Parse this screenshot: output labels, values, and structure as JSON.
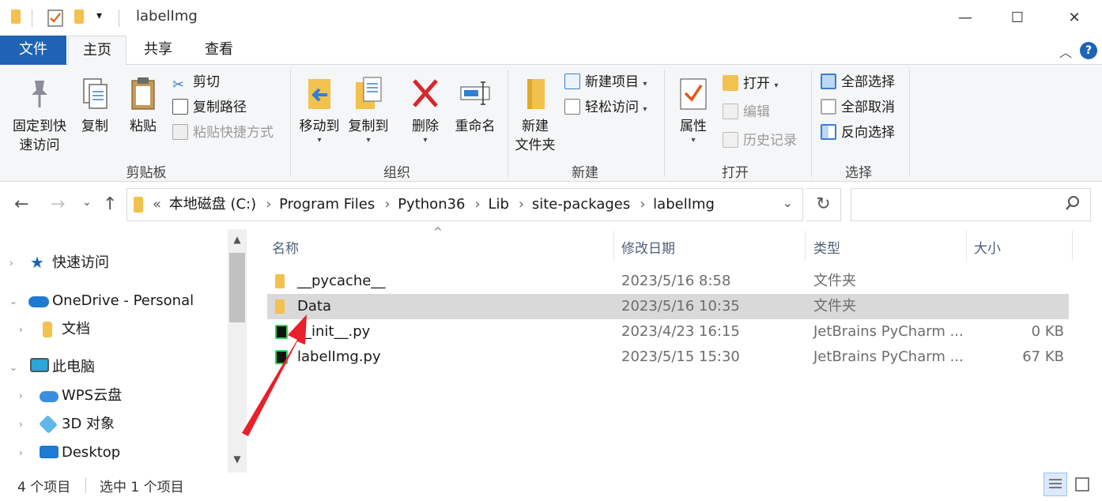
{
  "window": {
    "title": "labelImg",
    "minimize_glyph": "—",
    "maximize_glyph": "☐",
    "close_glyph": "✕",
    "qat_dropdown_glyph": "▾"
  },
  "ribbon_tabs": {
    "file": "文件",
    "home": "主页",
    "share": "共享",
    "view": "查看"
  },
  "ribbon": {
    "clipboard": {
      "group_label": "剪贴板",
      "pin_label_1": "固定到快",
      "pin_label_2": "速访问",
      "copy": "复制",
      "paste": "粘贴",
      "cut": "剪切",
      "copy_path": "复制路径",
      "paste_shortcut": "粘贴快捷方式"
    },
    "organize": {
      "group_label": "组织",
      "move_to": "移动到",
      "copy_to": "复制到",
      "delete": "删除",
      "rename": "重命名"
    },
    "new": {
      "group_label": "新建",
      "new_folder_1": "新建",
      "new_folder_2": "文件夹",
      "new_item": "新建项目",
      "easy_access": "轻松访问"
    },
    "open": {
      "group_label": "打开",
      "properties": "属性",
      "open": "打开",
      "edit": "编辑",
      "history": "历史记录"
    },
    "select": {
      "group_label": "选择",
      "select_all": "全部选择",
      "select_none": "全部取消",
      "invert": "反向选择"
    },
    "dropdown_glyph": "▾",
    "collapse_glyph": "︿",
    "help_glyph": "?"
  },
  "navigation": {
    "back_glyph": "←",
    "forward_glyph": "→",
    "recent_glyph": "⌄",
    "up_glyph": "↑",
    "overflow": "«",
    "breadcrumbs": [
      "本地磁盘 (C:)",
      "Program Files",
      "Python36",
      "Lib",
      "site-packages",
      "labelImg"
    ],
    "crumb_sep": "›",
    "address_dropdown_glyph": "⌄",
    "refresh_glyph": "↻",
    "search_placeholder": "",
    "search_glyph": "⚲"
  },
  "nav_pane": {
    "items": [
      {
        "label": "快速访问",
        "icon": "star-icon",
        "color": "#1e63b4"
      },
      {
        "label": "OneDrive - Personal",
        "icon": "cloud-icon",
        "color": "#1e7ad3"
      },
      {
        "label": "文档",
        "icon": "folder-icon",
        "color": "#f2c14e"
      },
      {
        "label": "此电脑",
        "icon": "computer-icon",
        "color": "#2aa7d6"
      },
      {
        "label": "WPS云盘",
        "icon": "cloud-icon",
        "color": "#3a8de0"
      },
      {
        "label": "3D 对象",
        "icon": "cube-icon",
        "color": "#5fb6e8"
      },
      {
        "label": "Desktop",
        "icon": "desktop-icon",
        "color": "#1e7ad3"
      }
    ],
    "expand_glyph": "›",
    "collapse_glyph": "⌄",
    "scroll_up_glyph": "▲",
    "scroll_down_glyph": "▼"
  },
  "file_list": {
    "columns": {
      "name": "名称",
      "date": "修改日期",
      "type": "类型",
      "size": "大小"
    },
    "sort_glyph": "^",
    "rows": [
      {
        "name": "__pycache__",
        "date": "2023/5/16 8:58",
        "type": "文件夹",
        "size": "",
        "icon": "folder-icon",
        "selected": false
      },
      {
        "name": "Data",
        "date": "2023/5/16 10:35",
        "type": "文件夹",
        "size": "",
        "icon": "folder-icon",
        "selected": true
      },
      {
        "name": "__init__.py",
        "date": "2023/4/23 16:15",
        "type": "JetBrains PyCharm ...",
        "size": "0 KB",
        "icon": "pycharm-file-icon",
        "selected": false
      },
      {
        "name": "labelImg.py",
        "date": "2023/5/15 15:30",
        "type": "JetBrains PyCharm ...",
        "size": "67 KB",
        "icon": "pycharm-file-icon",
        "selected": false
      }
    ]
  },
  "status_bar": {
    "item_count": "4 个项目",
    "selected_count": "选中 1 个项目"
  },
  "colors": {
    "accent": "#1e63b4",
    "folder": "#f2c14e",
    "selection": "#d9d9d9",
    "annotation_arrow": "#e8202a"
  }
}
